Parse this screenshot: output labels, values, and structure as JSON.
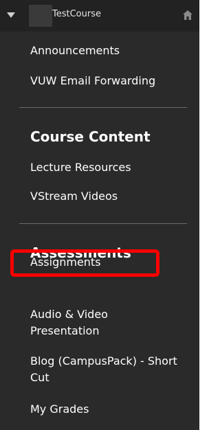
{
  "header": {
    "course_name": "TestCourse",
    "icons": {
      "collapse": "chevron-down-icon",
      "home": "home-icon"
    }
  },
  "menu": {
    "top_items": [
      "Announcements",
      "VUW Email Forwarding"
    ],
    "course_content": {
      "title": "Course Content",
      "items": [
        "Lecture Resources",
        "VStream Videos"
      ]
    },
    "assessments": {
      "title": "Assessments",
      "items": [
        "Assignments",
        "Audio & Video Presentation",
        "Blog (CampusPack) - Short Cut",
        "My Grades"
      ]
    }
  },
  "colors": {
    "menu_background": "#2a2a2a",
    "header_background": "#222222",
    "text": "#ffffff",
    "divider": "#6a6a6a",
    "highlight": "#ff0000"
  }
}
